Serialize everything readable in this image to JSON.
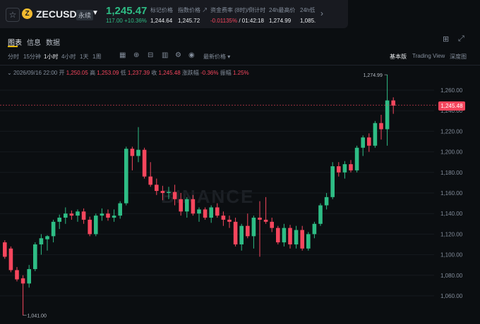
{
  "header": {
    "star_icon": "star-icon",
    "coin_icon_letter": "Z",
    "symbol": "ZECUSDT",
    "perpetual_badge": "永续",
    "last_price": "1,245.47",
    "change": "117.00 +10.36%",
    "stats": [
      {
        "label": "标记价格",
        "value": "1,244.64"
      },
      {
        "label": "指数价格 ↗",
        "value": "1,245.72"
      },
      {
        "label": "资金费率 (8时)/倒计时",
        "value_neg": "-0.01135%",
        "value_rest": " / 01:42:18"
      },
      {
        "label": "24h最高价",
        "value": "1,274.99"
      },
      {
        "label": "24h低",
        "value": "1,085..."
      }
    ]
  },
  "tabs": [
    "图表",
    "信息",
    "数据"
  ],
  "toolbar": {
    "intervals": [
      "分时",
      "15分钟",
      "1小时",
      "4小时",
      "1天",
      "1周"
    ],
    "active_interval": "1小时",
    "price_type": "最新价格",
    "views": [
      "基本版",
      "Trading View",
      "深度图"
    ],
    "active_view": "基本版"
  },
  "ohlc": {
    "date": "2026/09/16 22:00",
    "open_label": "开",
    "open": "1,250.05",
    "high_label": "高",
    "high": "1,253.09",
    "low_label": "低",
    "low": "1,237.39",
    "close_label": "收",
    "close": "1,245.48",
    "change_label": "涨跌幅",
    "change": "-0.36%",
    "amp_label": "振幅",
    "amp": "1.25%"
  },
  "watermark": "BINANCE",
  "colors": {
    "up": "#2ebd85",
    "down": "#f6465d",
    "accent": "#f0b90b"
  },
  "chart_data": {
    "type": "candlestick",
    "y_ticks": [
      "1,260.00",
      "1,240.00",
      "1,220.00",
      "1,200.00",
      "1,180.00",
      "1,160.00",
      "1,140.00",
      "1,120.00",
      "1,100.00",
      "1,080.00",
      "1,060.00"
    ],
    "y_tick_values": [
      1260,
      1240,
      1220,
      1200,
      1180,
      1160,
      1140,
      1120,
      1100,
      1080,
      1060
    ],
    "ylim": [
      1041,
      1278
    ],
    "last_price_tag": "1,245.48",
    "last_price_value": 1245.48,
    "high_annotation": "1,274.99",
    "high_value": 1274.99,
    "low_annotation": "1,041.00",
    "low_value": 1041,
    "candles": [
      {
        "o": 1112,
        "h": 1114,
        "l": 1096,
        "c": 1098
      },
      {
        "o": 1106,
        "h": 1108,
        "l": 1083,
        "c": 1085
      },
      {
        "o": 1085,
        "h": 1088,
        "l": 1074,
        "c": 1076
      },
      {
        "o": 1077,
        "h": 1080,
        "l": 1041,
        "c": 1072
      },
      {
        "o": 1072,
        "h": 1090,
        "l": 1068,
        "c": 1086
      },
      {
        "o": 1086,
        "h": 1112,
        "l": 1084,
        "c": 1110
      },
      {
        "o": 1110,
        "h": 1120,
        "l": 1100,
        "c": 1116
      },
      {
        "o": 1115,
        "h": 1119,
        "l": 1104,
        "c": 1118
      },
      {
        "o": 1118,
        "h": 1134,
        "l": 1112,
        "c": 1132
      },
      {
        "o": 1132,
        "h": 1139,
        "l": 1125,
        "c": 1136
      },
      {
        "o": 1136,
        "h": 1146,
        "l": 1130,
        "c": 1140
      },
      {
        "o": 1140,
        "h": 1143,
        "l": 1134,
        "c": 1138
      },
      {
        "o": 1138,
        "h": 1144,
        "l": 1132,
        "c": 1142
      },
      {
        "o": 1142,
        "h": 1145,
        "l": 1130,
        "c": 1134
      },
      {
        "o": 1134,
        "h": 1137,
        "l": 1118,
        "c": 1120
      },
      {
        "o": 1120,
        "h": 1140,
        "l": 1118,
        "c": 1138
      },
      {
        "o": 1138,
        "h": 1145,
        "l": 1133,
        "c": 1140
      },
      {
        "o": 1140,
        "h": 1144,
        "l": 1133,
        "c": 1136
      },
      {
        "o": 1136,
        "h": 1144,
        "l": 1132,
        "c": 1138
      },
      {
        "o": 1138,
        "h": 1152,
        "l": 1135,
        "c": 1150
      },
      {
        "o": 1150,
        "h": 1205,
        "l": 1148,
        "c": 1203
      },
      {
        "o": 1203,
        "h": 1205,
        "l": 1182,
        "c": 1196
      },
      {
        "o": 1196,
        "h": 1224,
        "l": 1190,
        "c": 1202
      },
      {
        "o": 1202,
        "h": 1204,
        "l": 1174,
        "c": 1176
      },
      {
        "o": 1176,
        "h": 1190,
        "l": 1166,
        "c": 1168
      },
      {
        "o": 1168,
        "h": 1174,
        "l": 1158,
        "c": 1162
      },
      {
        "o": 1162,
        "h": 1167,
        "l": 1153,
        "c": 1160
      },
      {
        "o": 1160,
        "h": 1166,
        "l": 1154,
        "c": 1161
      },
      {
        "o": 1161,
        "h": 1168,
        "l": 1148,
        "c": 1154
      },
      {
        "o": 1154,
        "h": 1160,
        "l": 1138,
        "c": 1142
      },
      {
        "o": 1142,
        "h": 1156,
        "l": 1136,
        "c": 1154
      },
      {
        "o": 1154,
        "h": 1158,
        "l": 1138,
        "c": 1140
      },
      {
        "o": 1140,
        "h": 1146,
        "l": 1132,
        "c": 1144
      },
      {
        "o": 1144,
        "h": 1146,
        "l": 1134,
        "c": 1136
      },
      {
        "o": 1136,
        "h": 1148,
        "l": 1131,
        "c": 1146
      },
      {
        "o": 1146,
        "h": 1150,
        "l": 1136,
        "c": 1138
      },
      {
        "o": 1138,
        "h": 1142,
        "l": 1128,
        "c": 1134
      },
      {
        "o": 1134,
        "h": 1138,
        "l": 1126,
        "c": 1132
      },
      {
        "o": 1132,
        "h": 1136,
        "l": 1108,
        "c": 1110
      },
      {
        "o": 1110,
        "h": 1130,
        "l": 1104,
        "c": 1128
      },
      {
        "o": 1128,
        "h": 1140,
        "l": 1116,
        "c": 1118
      },
      {
        "o": 1118,
        "h": 1138,
        "l": 1106,
        "c": 1136
      },
      {
        "o": 1136,
        "h": 1152,
        "l": 1098,
        "c": 1134
      },
      {
        "o": 1134,
        "h": 1156,
        "l": 1130,
        "c": 1132
      },
      {
        "o": 1132,
        "h": 1136,
        "l": 1122,
        "c": 1126
      },
      {
        "o": 1126,
        "h": 1128,
        "l": 1110,
        "c": 1112
      },
      {
        "o": 1112,
        "h": 1130,
        "l": 1108,
        "c": 1126
      },
      {
        "o": 1126,
        "h": 1129,
        "l": 1106,
        "c": 1110
      },
      {
        "o": 1110,
        "h": 1128,
        "l": 1106,
        "c": 1124
      },
      {
        "o": 1124,
        "h": 1128,
        "l": 1104,
        "c": 1106
      },
      {
        "o": 1106,
        "h": 1122,
        "l": 1104,
        "c": 1120
      },
      {
        "o": 1120,
        "h": 1132,
        "l": 1116,
        "c": 1130
      },
      {
        "o": 1130,
        "h": 1150,
        "l": 1128,
        "c": 1148
      },
      {
        "o": 1148,
        "h": 1160,
        "l": 1144,
        "c": 1156
      },
      {
        "o": 1156,
        "h": 1190,
        "l": 1154,
        "c": 1186
      },
      {
        "o": 1186,
        "h": 1190,
        "l": 1176,
        "c": 1180
      },
      {
        "o": 1180,
        "h": 1191,
        "l": 1174,
        "c": 1188
      },
      {
        "o": 1188,
        "h": 1192,
        "l": 1180,
        "c": 1182
      },
      {
        "o": 1182,
        "h": 1206,
        "l": 1180,
        "c": 1204
      },
      {
        "o": 1204,
        "h": 1216,
        "l": 1196,
        "c": 1214
      },
      {
        "o": 1214,
        "h": 1218,
        "l": 1200,
        "c": 1206
      },
      {
        "o": 1206,
        "h": 1230,
        "l": 1204,
        "c": 1228
      },
      {
        "o": 1228,
        "h": 1236,
        "l": 1212,
        "c": 1222
      },
      {
        "o": 1222,
        "h": 1275,
        "l": 1206,
        "c": 1250
      },
      {
        "o": 1250,
        "h": 1253,
        "l": 1237,
        "c": 1245
      }
    ]
  }
}
